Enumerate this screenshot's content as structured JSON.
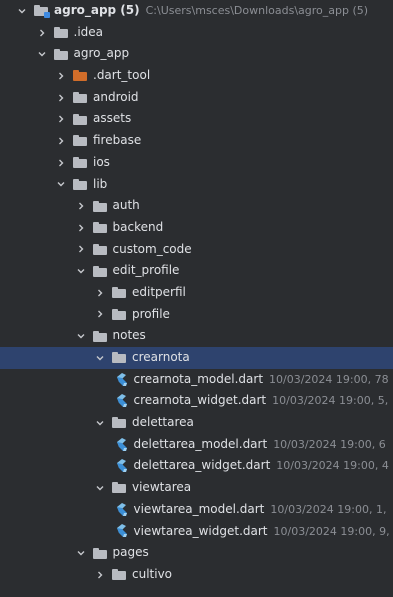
{
  "tree": {
    "rows": [
      {
        "label": "agro_app (5)",
        "meta": "C:\\Users\\msces\\Downloads\\agro_app (5)",
        "indent": 0,
        "expanded": true,
        "type": "module"
      },
      {
        "label": ".idea",
        "indent": 1,
        "expanded": false,
        "type": "folder"
      },
      {
        "label": "agro_app",
        "indent": 1,
        "expanded": true,
        "type": "folder"
      },
      {
        "label": ".dart_tool",
        "indent": 2,
        "expanded": false,
        "type": "folder-orange"
      },
      {
        "label": "android",
        "indent": 2,
        "expanded": false,
        "type": "folder"
      },
      {
        "label": "assets",
        "indent": 2,
        "expanded": false,
        "type": "folder"
      },
      {
        "label": "firebase",
        "indent": 2,
        "expanded": false,
        "type": "folder"
      },
      {
        "label": "ios",
        "indent": 2,
        "expanded": false,
        "type": "folder"
      },
      {
        "label": "lib",
        "indent": 2,
        "expanded": true,
        "type": "folder"
      },
      {
        "label": "auth",
        "indent": 3,
        "expanded": false,
        "type": "folder"
      },
      {
        "label": "backend",
        "indent": 3,
        "expanded": false,
        "type": "folder"
      },
      {
        "label": "custom_code",
        "indent": 3,
        "expanded": false,
        "type": "folder"
      },
      {
        "label": "edit_profile",
        "indent": 3,
        "expanded": true,
        "type": "folder"
      },
      {
        "label": "editperfil",
        "indent": 4,
        "expanded": false,
        "type": "folder"
      },
      {
        "label": "profile",
        "indent": 4,
        "expanded": false,
        "type": "folder"
      },
      {
        "label": "notes",
        "indent": 3,
        "expanded": true,
        "type": "folder"
      },
      {
        "label": "crearnota",
        "indent": 4,
        "expanded": true,
        "type": "folder",
        "selected": true
      },
      {
        "label": "crearnota_model.dart",
        "meta": "10/03/2024 19:00, 78",
        "indent": 5,
        "type": "dart"
      },
      {
        "label": "crearnota_widget.dart",
        "meta": "10/03/2024 19:00, 5,",
        "indent": 5,
        "type": "dart"
      },
      {
        "label": "delettarea",
        "indent": 4,
        "expanded": true,
        "type": "folder"
      },
      {
        "label": "delettarea_model.dart",
        "meta": "10/03/2024 19:00, 6",
        "indent": 5,
        "type": "dart"
      },
      {
        "label": "delettarea_widget.dart",
        "meta": "10/03/2024 19:00, 4",
        "indent": 5,
        "type": "dart"
      },
      {
        "label": "viewtarea",
        "indent": 4,
        "expanded": true,
        "type": "folder"
      },
      {
        "label": "viewtarea_model.dart",
        "meta": "10/03/2024 19:00, 1,",
        "indent": 5,
        "type": "dart"
      },
      {
        "label": "viewtarea_widget.dart",
        "meta": "10/03/2024 19:00, 9,",
        "indent": 5,
        "type": "dart"
      },
      {
        "label": "pages",
        "indent": 3,
        "expanded": true,
        "type": "folder"
      },
      {
        "label": "cultivo",
        "indent": 4,
        "expanded": false,
        "type": "folder"
      }
    ]
  },
  "colors": {
    "background": "#2b2d30",
    "selection": "#2e436e",
    "text": "#dfe1e5",
    "meta_text": "#8b8e94",
    "folder": "#b8bbc1",
    "excluded_folder": "#d16d2a",
    "dart_icon": "#4aa3df"
  },
  "icons": {
    "expanded": "chevron-down-icon",
    "collapsed": "chevron-right-icon",
    "folder": "folder-icon",
    "dart_file": "dart-file-icon"
  }
}
